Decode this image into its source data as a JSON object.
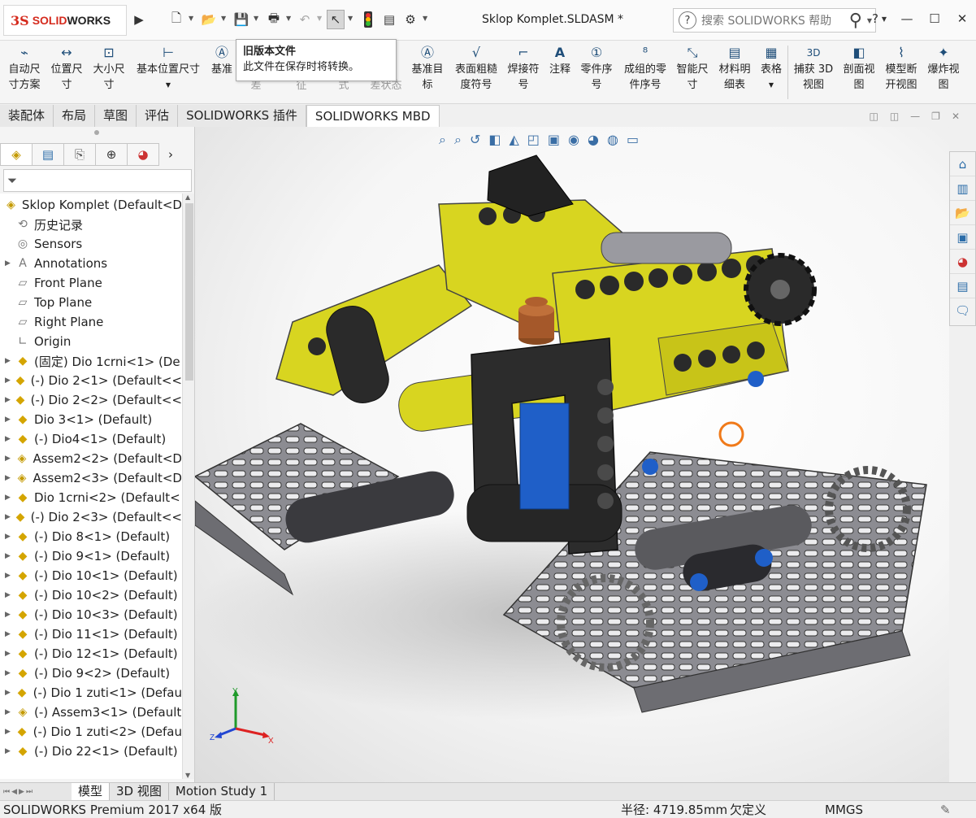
{
  "app": {
    "logo_ds": "3S",
    "logo_text_solid": "SOLID",
    "logo_text_works": "WORKS",
    "doc_title": "Sklop Komplet.SLDASM *",
    "search_placeholder": "搜索 SOLIDWORKS 帮助",
    "help_label": "?"
  },
  "ribbon": {
    "buttons": [
      {
        "l1": "自动尺",
        "l2": "寸方案",
        "icon": "auto-dimension-icon",
        "glyph": "⌁"
      },
      {
        "l1": "位置尺",
        "l2": "寸",
        "icon": "location-dimension-icon",
        "glyph": "↔"
      },
      {
        "l1": "大小尺",
        "l2": "寸",
        "icon": "size-dimension-icon",
        "glyph": "⊡"
      },
      {
        "l1": "基本位置尺寸",
        "l2": "",
        "icon": "basic-location-icon",
        "glyph": "⊢"
      },
      {
        "l1": "基准",
        "l2": "",
        "icon": "datum-icon",
        "glyph": "A"
      },
      {
        "l1": "基准目",
        "l2": "标",
        "icon": "datum-target-icon",
        "glyph": "Ⓐ"
      },
      {
        "l1": "表面粗糙",
        "l2": "度符号",
        "icon": "surface-finish-icon",
        "glyph": "√"
      },
      {
        "l1": "焊接符",
        "l2": "号",
        "icon": "weld-symbol-icon",
        "glyph": "⌐"
      },
      {
        "l1": "注释",
        "l2": "",
        "icon": "note-icon",
        "glyph": "A"
      },
      {
        "l1": "零件序",
        "l2": "号",
        "icon": "balloon-icon",
        "glyph": "①"
      },
      {
        "l1": "成组的零",
        "l2": "件序号",
        "icon": "stacked-balloon-icon",
        "glyph": "⁸"
      },
      {
        "l1": "智能尺",
        "l2": "寸",
        "icon": "smart-dimension-icon",
        "glyph": "⤡"
      },
      {
        "l1": "材料明",
        "l2": "细表",
        "icon": "bom-icon",
        "glyph": "▤"
      },
      {
        "l1": "表格",
        "l2": "",
        "icon": "table-icon",
        "glyph": "▦"
      },
      {
        "l1": "捕获 3D",
        "l2": "视图",
        "icon": "capture-3d-view-icon",
        "glyph": "3D"
      },
      {
        "l1": "剖面视",
        "l2": "图",
        "icon": "section-view-icon",
        "glyph": "◧"
      },
      {
        "l1": "模型断",
        "l2": "开视图",
        "icon": "model-break-view-icon",
        "glyph": "⌇"
      },
      {
        "l1": "爆炸视",
        "l2": "图",
        "icon": "exploded-view-icon",
        "glyph": "✦"
      }
    ],
    "hidden_partial": [
      "差",
      "征",
      "式",
      "差状态"
    ]
  },
  "tooltip": {
    "title": "旧版本文件",
    "body": "此文件在保存时将转换。"
  },
  "tabs": [
    "装配体",
    "布局",
    "草图",
    "评估",
    "SOLIDWORKS 插件",
    "SOLIDWORKS MBD"
  ],
  "active_tab": "SOLIDWORKS MBD",
  "tree": {
    "root": "Sklop Komplet  (Default<D",
    "items": [
      {
        "label": "历史记录",
        "icon": "history-icon",
        "glyph": "⟲",
        "exp": false
      },
      {
        "label": "Sensors",
        "icon": "sensors-icon",
        "glyph": "◎",
        "exp": false
      },
      {
        "label": "Annotations",
        "icon": "annotations-icon",
        "glyph": "A",
        "exp": true
      },
      {
        "label": "Front Plane",
        "icon": "plane-icon",
        "glyph": "▱",
        "exp": false
      },
      {
        "label": "Top Plane",
        "icon": "plane-icon",
        "glyph": "▱",
        "exp": false
      },
      {
        "label": "Right Plane",
        "icon": "plane-icon",
        "glyph": "▱",
        "exp": false
      },
      {
        "label": "Origin",
        "icon": "origin-icon",
        "glyph": "∟",
        "exp": false
      },
      {
        "label": "(固定) Dio 1crni<1> (De",
        "icon": "part-icon",
        "glyph": "◆",
        "exp": true
      },
      {
        "label": "(-) Dio 2<1> (Default<<",
        "icon": "part-icon",
        "glyph": "◆",
        "exp": true
      },
      {
        "label": "(-) Dio 2<2> (Default<<",
        "icon": "part-icon",
        "glyph": "◆",
        "exp": true
      },
      {
        "label": "Dio 3<1> (Default)",
        "icon": "part-icon",
        "glyph": "◆",
        "exp": true
      },
      {
        "label": "(-) Dio4<1> (Default)",
        "icon": "part-icon",
        "glyph": "◆",
        "exp": true
      },
      {
        "label": "Assem2<2> (Default<D",
        "icon": "assembly-icon",
        "glyph": "◈",
        "exp": true
      },
      {
        "label": "Assem2<3> (Default<D",
        "icon": "assembly-icon",
        "glyph": "◈",
        "exp": true
      },
      {
        "label": "Dio 1crni<2> (Default<",
        "icon": "part-icon",
        "glyph": "◆",
        "exp": true
      },
      {
        "label": "(-) Dio 2<3> (Default<<",
        "icon": "part-icon",
        "glyph": "◆",
        "exp": true
      },
      {
        "label": "(-) Dio 8<1> (Default)",
        "icon": "part-icon",
        "glyph": "◆",
        "exp": true
      },
      {
        "label": "(-) Dio 9<1> (Default)",
        "icon": "part-icon",
        "glyph": "◆",
        "exp": true
      },
      {
        "label": "(-) Dio 10<1> (Default)",
        "icon": "part-icon",
        "glyph": "◆",
        "exp": true
      },
      {
        "label": "(-) Dio 10<2> (Default)",
        "icon": "part-icon",
        "glyph": "◆",
        "exp": true
      },
      {
        "label": "(-) Dio 10<3> (Default)",
        "icon": "part-icon",
        "glyph": "◆",
        "exp": true
      },
      {
        "label": "(-) Dio 11<1> (Default)",
        "icon": "part-icon",
        "glyph": "◆",
        "exp": true
      },
      {
        "label": "(-) Dio 12<1> (Default)",
        "icon": "part-icon",
        "glyph": "◆",
        "exp": true
      },
      {
        "label": "(-) Dio 9<2> (Default)",
        "icon": "part-icon",
        "glyph": "◆",
        "exp": true
      },
      {
        "label": "(-) Dio 1 zuti<1> (Defau",
        "icon": "part-icon",
        "glyph": "◆",
        "exp": true
      },
      {
        "label": "(-) Assem3<1> (Default",
        "icon": "assembly-icon",
        "glyph": "◈",
        "exp": true
      },
      {
        "label": "(-) Dio 1 zuti<2> (Defau",
        "icon": "part-icon",
        "glyph": "◆",
        "exp": true
      },
      {
        "label": "(-) Dio 22<1> (Default)",
        "icon": "part-icon",
        "glyph": "◆",
        "exp": true
      }
    ]
  },
  "bottom_tabs": [
    "模型",
    "3D 视图",
    "Motion Study 1"
  ],
  "active_bottom_tab": "模型",
  "status": {
    "product": "SOLIDWORKS Premium 2017 x64 版",
    "radius": "半径: 4719.85mm",
    "state": "欠定义",
    "units": "MMGS"
  },
  "triad": {
    "x": "X",
    "y": "Y",
    "z": "Z"
  },
  "colors": {
    "brand_red": "#d52b1e",
    "part_yellow": "#d8d520",
    "dark": "#2a2a2a",
    "grey": "#8a8a8e",
    "blue": "#1f5fc8"
  }
}
